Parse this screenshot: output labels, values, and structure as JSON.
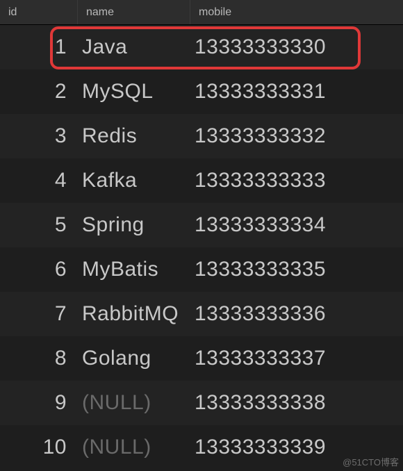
{
  "columns": {
    "id": "id",
    "name": "name",
    "mobile": "mobile"
  },
  "rows": [
    {
      "id": "1",
      "name": "Java",
      "mobile": "13333333330",
      "name_null": false
    },
    {
      "id": "2",
      "name": "MySQL",
      "mobile": "13333333331",
      "name_null": false
    },
    {
      "id": "3",
      "name": "Redis",
      "mobile": "13333333332",
      "name_null": false
    },
    {
      "id": "4",
      "name": "Kafka",
      "mobile": "13333333333",
      "name_null": false
    },
    {
      "id": "5",
      "name": "Spring",
      "mobile": "13333333334",
      "name_null": false
    },
    {
      "id": "6",
      "name": "MyBatis",
      "mobile": "13333333335",
      "name_null": false
    },
    {
      "id": "7",
      "name": "RabbitMQ",
      "mobile": "13333333336",
      "name_null": false
    },
    {
      "id": "8",
      "name": "Golang",
      "mobile": "13333333337",
      "name_null": false
    },
    {
      "id": "9",
      "name": "(NULL)",
      "mobile": "13333333338",
      "name_null": true
    },
    {
      "id": "10",
      "name": "(NULL)",
      "mobile": "13333333339",
      "name_null": true
    }
  ],
  "highlight_row_index": 0,
  "watermark": "@51CTO博客"
}
